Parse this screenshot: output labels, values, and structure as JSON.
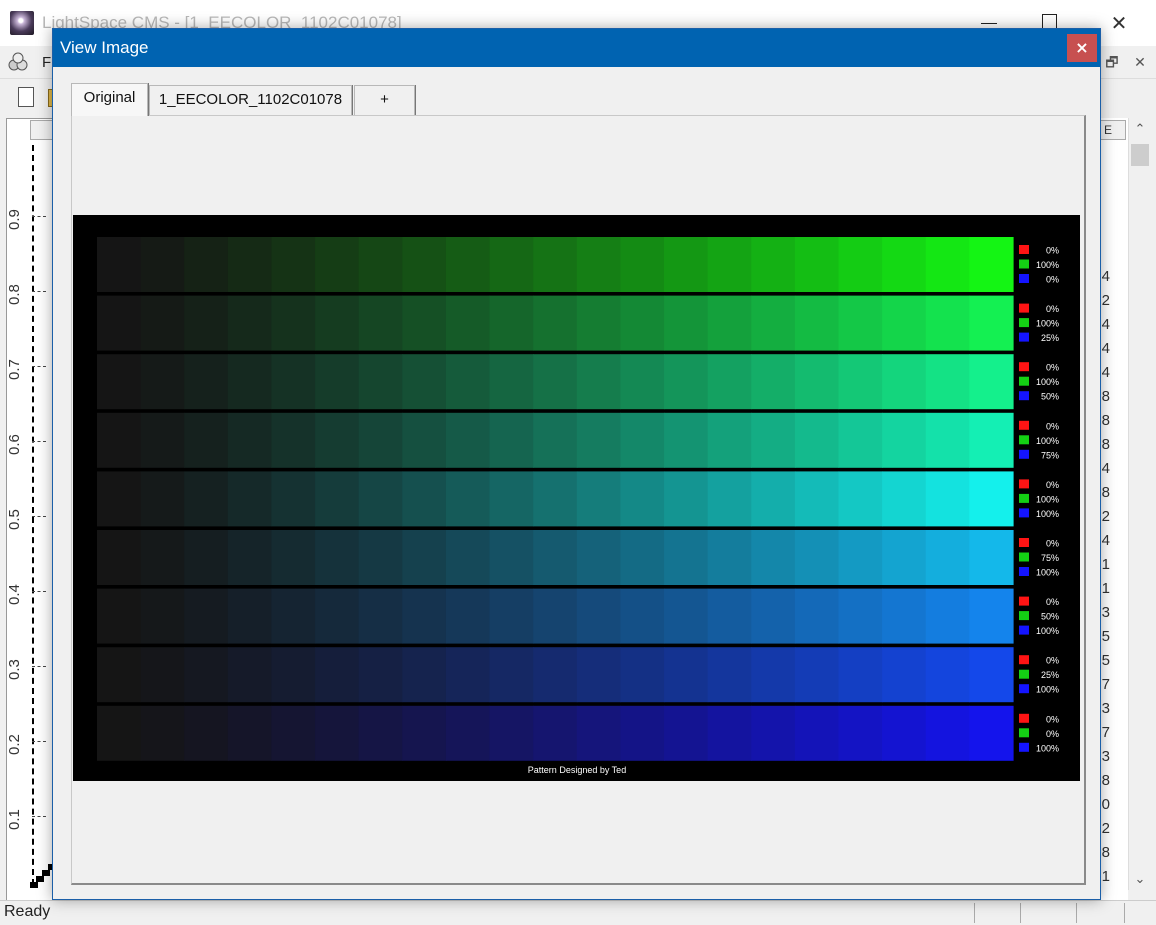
{
  "main_window": {
    "title": "LightSpace CMS - [1_EECOLOR_1102C01078]",
    "menu_first_letter": "F",
    "status": "Ready",
    "chart_yticks": [
      "0.9",
      "0.8",
      "0.7",
      "0.6",
      "0.5",
      "0.4",
      "0.3",
      "0.2",
      "0.1"
    ],
    "right_column_header": "E",
    "right_column_digits": [
      "4",
      "2",
      "4",
      "4",
      "4",
      "8",
      "8",
      "8",
      "4",
      "8",
      "2",
      "4",
      "1",
      "1",
      "3",
      "5",
      "5",
      "7",
      "3",
      "7",
      "3",
      "8",
      "0",
      "2",
      "8",
      "1"
    ]
  },
  "dialog": {
    "title": "View Image",
    "close_glyph": "×",
    "tabs": [
      {
        "label": "Original",
        "active": true
      },
      {
        "label": "1_EECOLOR_1102C01078",
        "active": false
      },
      {
        "label": "+",
        "active": false
      }
    ]
  },
  "pattern": {
    "credit": "Pattern Designed by Ted",
    "steps_per_row": 21,
    "rows": [
      {
        "r": "0%",
        "g": "100%",
        "b": "0%",
        "color": "#14f514"
      },
      {
        "r": "0%",
        "g": "100%",
        "b": "25%",
        "color": "#14f052"
      },
      {
        "r": "0%",
        "g": "100%",
        "b": "50%",
        "color": "#14f08c"
      },
      {
        "r": "0%",
        "g": "100%",
        "b": "75%",
        "color": "#14efb4"
      },
      {
        "r": "0%",
        "g": "100%",
        "b": "100%",
        "color": "#14f0ec"
      },
      {
        "r": "0%",
        "g": "75%",
        "b": "100%",
        "color": "#14b8ea"
      },
      {
        "r": "0%",
        "g": "50%",
        "b": "100%",
        "color": "#1484ec"
      },
      {
        "r": "0%",
        "g": "25%",
        "b": "100%",
        "color": "#1448ea"
      },
      {
        "r": "0%",
        "g": "0%",
        "b": "100%",
        "color": "#1414ec"
      }
    ],
    "swatch_colors": {
      "r": "#ff1414",
      "g": "#14d014",
      "b": "#1414ff"
    },
    "start_color": "#151515"
  }
}
